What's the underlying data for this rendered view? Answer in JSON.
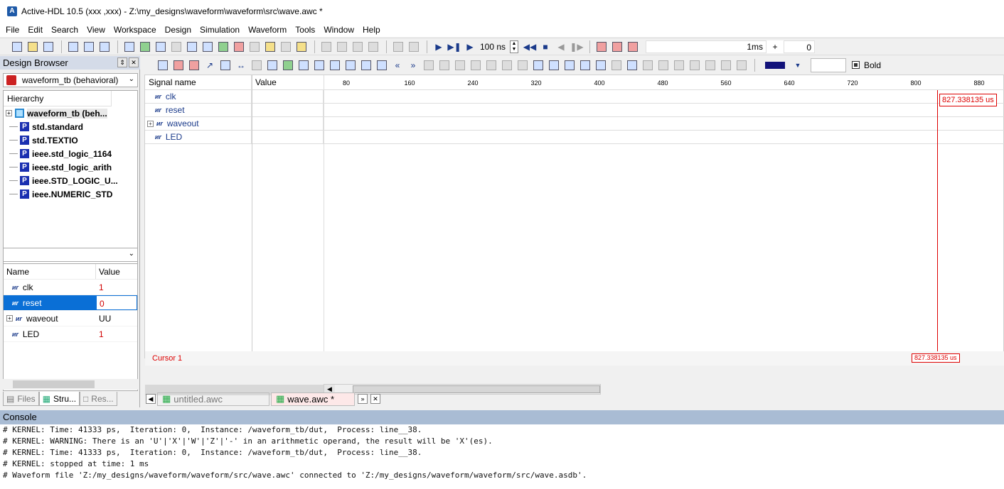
{
  "window": {
    "title": "Active-HDL 10.5 (xxx ,xxx) - Z:\\my_designs\\waveform\\waveform\\src\\wave.awc *"
  },
  "menu": [
    "File",
    "Edit",
    "Search",
    "View",
    "Workspace",
    "Design",
    "Simulation",
    "Waveform",
    "Tools",
    "Window",
    "Help"
  ],
  "toolbar": {
    "sim_step": "100 ns",
    "end_time": "1ms",
    "plus": "+",
    "counter": "0"
  },
  "design_browser": {
    "title": "Design Browser",
    "selected_design": "waveform_tb (behavioral)",
    "hierarchy_header": "Hierarchy",
    "items": [
      {
        "label": "waveform_tb (beh..."
      },
      {
        "label": "std.standard"
      },
      {
        "label": "std.TEXTIO"
      },
      {
        "label": "ieee.std_logic_1164"
      },
      {
        "label": "ieee.std_logic_arith"
      },
      {
        "label": "ieee.STD_LOGIC_U..."
      },
      {
        "label": "ieee.NUMERIC_STD"
      }
    ],
    "props_header": {
      "name": "Name",
      "value": "Value"
    },
    "props": [
      {
        "name": "clk",
        "value": "1"
      },
      {
        "name": "reset",
        "value": "0"
      },
      {
        "name": "waveout",
        "value": "UU"
      },
      {
        "name": "LED",
        "value": "1"
      }
    ],
    "tabs": [
      "Files",
      "Stru...",
      "Res..."
    ]
  },
  "wave": {
    "format": {
      "bold_label": "Bold"
    },
    "columns": {
      "signal": "Signal name",
      "value": "Value"
    },
    "ruler_labels": [
      "80",
      "160",
      "240",
      "320",
      "400",
      "480",
      "560",
      "640",
      "720",
      "800",
      "880"
    ],
    "signals": [
      {
        "name": "clk"
      },
      {
        "name": "reset"
      },
      {
        "name": "waveout"
      },
      {
        "name": "LED"
      }
    ],
    "cursor": {
      "name": "Cursor 1",
      "time": "827.338135 us"
    },
    "tabs": [
      "untitled.awc",
      "wave.awc *"
    ]
  },
  "console": {
    "title": "Console",
    "lines": [
      "# KERNEL: Time: 41333 ps,  Iteration: 0,  Instance: /waveform_tb/dut,  Process: line__38.",
      "# KERNEL: WARNING: There is an 'U'|'X'|'W'|'Z'|'-' in an arithmetic operand, the result will be 'X'(es).",
      "# KERNEL: Time: 41333 ps,  Iteration: 0,  Instance: /waveform_tb/dut,  Process: line__38.",
      "# KERNEL: stopped at time: 1 ms",
      "# Waveform file 'Z:/my_designs/waveform/waveform/src/wave.awc' connected to 'Z:/my_designs/waveform/waveform/src/wave.asdb'."
    ]
  }
}
